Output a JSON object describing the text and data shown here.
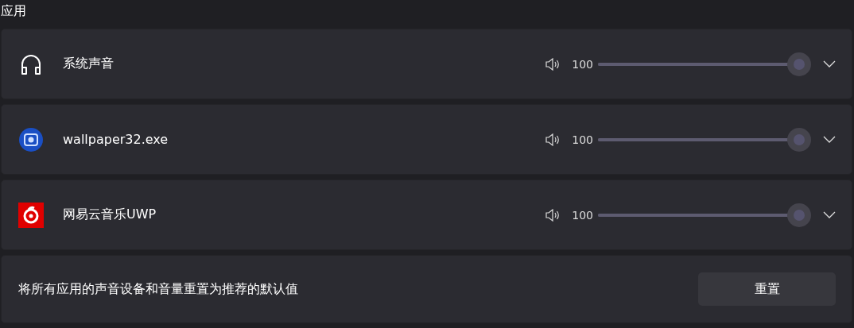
{
  "section_title": "应用",
  "apps": [
    {
      "kind": "headphones",
      "name": "系统声音",
      "volume": "100",
      "level": 1.0,
      "expanded": false
    },
    {
      "kind": "gear-app",
      "name": "wallpaper32.exe",
      "volume": "100",
      "level": 1.0,
      "expanded": false
    },
    {
      "kind": "music-app",
      "name": "网易云音乐UWP",
      "volume": "100",
      "level": 1.0,
      "expanded": false
    }
  ],
  "reset": {
    "description": "将所有应用的声音设备和音量重置为推荐的默认值",
    "button": "重置"
  }
}
